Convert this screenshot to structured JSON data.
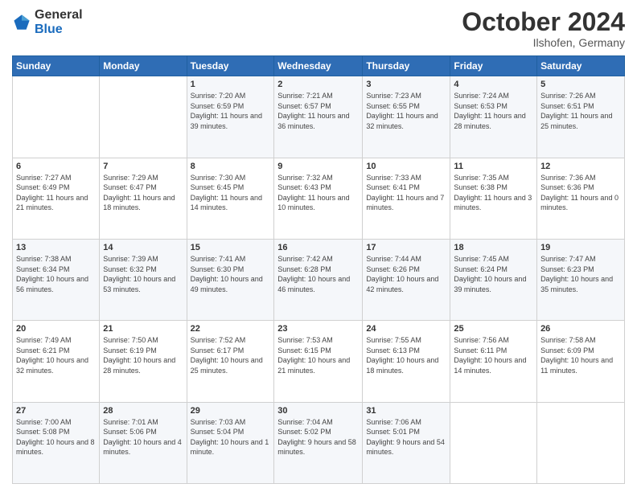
{
  "header": {
    "logo": {
      "general": "General",
      "blue": "Blue"
    },
    "title": "October 2024",
    "location": "Ilshofen, Germany"
  },
  "calendar": {
    "days_of_week": [
      "Sunday",
      "Monday",
      "Tuesday",
      "Wednesday",
      "Thursday",
      "Friday",
      "Saturday"
    ],
    "weeks": [
      [
        {
          "day": null,
          "sunrise": null,
          "sunset": null,
          "daylight": null
        },
        {
          "day": null,
          "sunrise": null,
          "sunset": null,
          "daylight": null
        },
        {
          "day": "1",
          "sunrise": "Sunrise: 7:20 AM",
          "sunset": "Sunset: 6:59 PM",
          "daylight": "Daylight: 11 hours and 39 minutes."
        },
        {
          "day": "2",
          "sunrise": "Sunrise: 7:21 AM",
          "sunset": "Sunset: 6:57 PM",
          "daylight": "Daylight: 11 hours and 36 minutes."
        },
        {
          "day": "3",
          "sunrise": "Sunrise: 7:23 AM",
          "sunset": "Sunset: 6:55 PM",
          "daylight": "Daylight: 11 hours and 32 minutes."
        },
        {
          "day": "4",
          "sunrise": "Sunrise: 7:24 AM",
          "sunset": "Sunset: 6:53 PM",
          "daylight": "Daylight: 11 hours and 28 minutes."
        },
        {
          "day": "5",
          "sunrise": "Sunrise: 7:26 AM",
          "sunset": "Sunset: 6:51 PM",
          "daylight": "Daylight: 11 hours and 25 minutes."
        }
      ],
      [
        {
          "day": "6",
          "sunrise": "Sunrise: 7:27 AM",
          "sunset": "Sunset: 6:49 PM",
          "daylight": "Daylight: 11 hours and 21 minutes."
        },
        {
          "day": "7",
          "sunrise": "Sunrise: 7:29 AM",
          "sunset": "Sunset: 6:47 PM",
          "daylight": "Daylight: 11 hours and 18 minutes."
        },
        {
          "day": "8",
          "sunrise": "Sunrise: 7:30 AM",
          "sunset": "Sunset: 6:45 PM",
          "daylight": "Daylight: 11 hours and 14 minutes."
        },
        {
          "day": "9",
          "sunrise": "Sunrise: 7:32 AM",
          "sunset": "Sunset: 6:43 PM",
          "daylight": "Daylight: 11 hours and 10 minutes."
        },
        {
          "day": "10",
          "sunrise": "Sunrise: 7:33 AM",
          "sunset": "Sunset: 6:41 PM",
          "daylight": "Daylight: 11 hours and 7 minutes."
        },
        {
          "day": "11",
          "sunrise": "Sunrise: 7:35 AM",
          "sunset": "Sunset: 6:38 PM",
          "daylight": "Daylight: 11 hours and 3 minutes."
        },
        {
          "day": "12",
          "sunrise": "Sunrise: 7:36 AM",
          "sunset": "Sunset: 6:36 PM",
          "daylight": "Daylight: 11 hours and 0 minutes."
        }
      ],
      [
        {
          "day": "13",
          "sunrise": "Sunrise: 7:38 AM",
          "sunset": "Sunset: 6:34 PM",
          "daylight": "Daylight: 10 hours and 56 minutes."
        },
        {
          "day": "14",
          "sunrise": "Sunrise: 7:39 AM",
          "sunset": "Sunset: 6:32 PM",
          "daylight": "Daylight: 10 hours and 53 minutes."
        },
        {
          "day": "15",
          "sunrise": "Sunrise: 7:41 AM",
          "sunset": "Sunset: 6:30 PM",
          "daylight": "Daylight: 10 hours and 49 minutes."
        },
        {
          "day": "16",
          "sunrise": "Sunrise: 7:42 AM",
          "sunset": "Sunset: 6:28 PM",
          "daylight": "Daylight: 10 hours and 46 minutes."
        },
        {
          "day": "17",
          "sunrise": "Sunrise: 7:44 AM",
          "sunset": "Sunset: 6:26 PM",
          "daylight": "Daylight: 10 hours and 42 minutes."
        },
        {
          "day": "18",
          "sunrise": "Sunrise: 7:45 AM",
          "sunset": "Sunset: 6:24 PM",
          "daylight": "Daylight: 10 hours and 39 minutes."
        },
        {
          "day": "19",
          "sunrise": "Sunrise: 7:47 AM",
          "sunset": "Sunset: 6:23 PM",
          "daylight": "Daylight: 10 hours and 35 minutes."
        }
      ],
      [
        {
          "day": "20",
          "sunrise": "Sunrise: 7:49 AM",
          "sunset": "Sunset: 6:21 PM",
          "daylight": "Daylight: 10 hours and 32 minutes."
        },
        {
          "day": "21",
          "sunrise": "Sunrise: 7:50 AM",
          "sunset": "Sunset: 6:19 PM",
          "daylight": "Daylight: 10 hours and 28 minutes."
        },
        {
          "day": "22",
          "sunrise": "Sunrise: 7:52 AM",
          "sunset": "Sunset: 6:17 PM",
          "daylight": "Daylight: 10 hours and 25 minutes."
        },
        {
          "day": "23",
          "sunrise": "Sunrise: 7:53 AM",
          "sunset": "Sunset: 6:15 PM",
          "daylight": "Daylight: 10 hours and 21 minutes."
        },
        {
          "day": "24",
          "sunrise": "Sunrise: 7:55 AM",
          "sunset": "Sunset: 6:13 PM",
          "daylight": "Daylight: 10 hours and 18 minutes."
        },
        {
          "day": "25",
          "sunrise": "Sunrise: 7:56 AM",
          "sunset": "Sunset: 6:11 PM",
          "daylight": "Daylight: 10 hours and 14 minutes."
        },
        {
          "day": "26",
          "sunrise": "Sunrise: 7:58 AM",
          "sunset": "Sunset: 6:09 PM",
          "daylight": "Daylight: 10 hours and 11 minutes."
        }
      ],
      [
        {
          "day": "27",
          "sunrise": "Sunrise: 7:00 AM",
          "sunset": "Sunset: 5:08 PM",
          "daylight": "Daylight: 10 hours and 8 minutes."
        },
        {
          "day": "28",
          "sunrise": "Sunrise: 7:01 AM",
          "sunset": "Sunset: 5:06 PM",
          "daylight": "Daylight: 10 hours and 4 minutes."
        },
        {
          "day": "29",
          "sunrise": "Sunrise: 7:03 AM",
          "sunset": "Sunset: 5:04 PM",
          "daylight": "Daylight: 10 hours and 1 minute."
        },
        {
          "day": "30",
          "sunrise": "Sunrise: 7:04 AM",
          "sunset": "Sunset: 5:02 PM",
          "daylight": "Daylight: 9 hours and 58 minutes."
        },
        {
          "day": "31",
          "sunrise": "Sunrise: 7:06 AM",
          "sunset": "Sunset: 5:01 PM",
          "daylight": "Daylight: 9 hours and 54 minutes."
        },
        {
          "day": null,
          "sunrise": null,
          "sunset": null,
          "daylight": null
        },
        {
          "day": null,
          "sunrise": null,
          "sunset": null,
          "daylight": null
        }
      ]
    ]
  }
}
